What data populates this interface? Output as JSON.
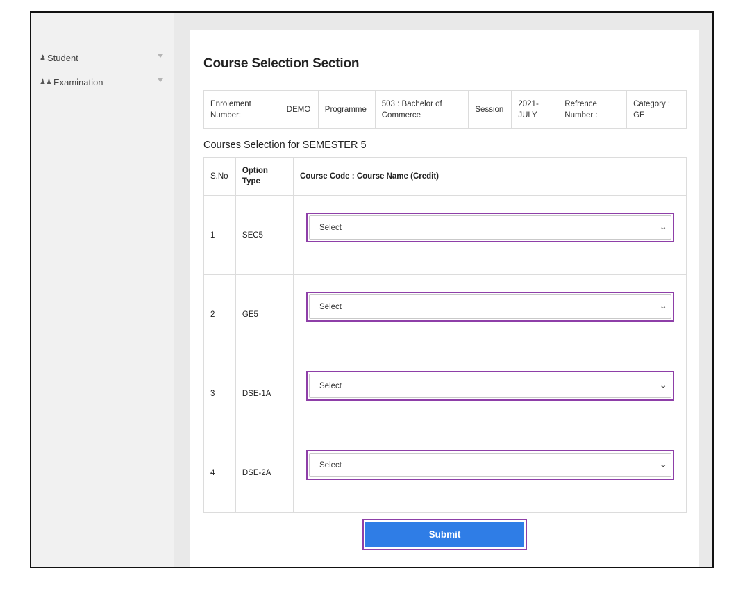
{
  "sidebar": {
    "items": [
      {
        "icon": "person-icon",
        "label": "Student"
      },
      {
        "icon": "people-icon",
        "label": "Examination"
      }
    ]
  },
  "page": {
    "title": "Course Selection Section"
  },
  "info": {
    "enrolment_label": "Enrolement Number:",
    "enrolment_value": "DEMO",
    "programme_label": "Programme",
    "programme_value": "503 : Bachelor of Commerce",
    "session_label": "Session",
    "session_value": "2021-JULY",
    "reference_label": "Refrence Number :",
    "category_label": "Category : GE"
  },
  "courses": {
    "heading": "Courses Selection for SEMESTER 5",
    "headers": {
      "sno": "S.No",
      "option_type": "Option Type",
      "course": "Course Code : Course Name (Credit)"
    },
    "rows": [
      {
        "sno": "1",
        "type": "SEC5",
        "selected": "Select"
      },
      {
        "sno": "2",
        "type": "GE5",
        "selected": "Select"
      },
      {
        "sno": "3",
        "type": "DSE-1A",
        "selected": "Select"
      },
      {
        "sno": "4",
        "type": "DSE-2A",
        "selected": "Select"
      }
    ]
  },
  "actions": {
    "submit_label": "Submit"
  },
  "colors": {
    "accent": "#2f7de6",
    "highlight": "#8e3fa8"
  }
}
